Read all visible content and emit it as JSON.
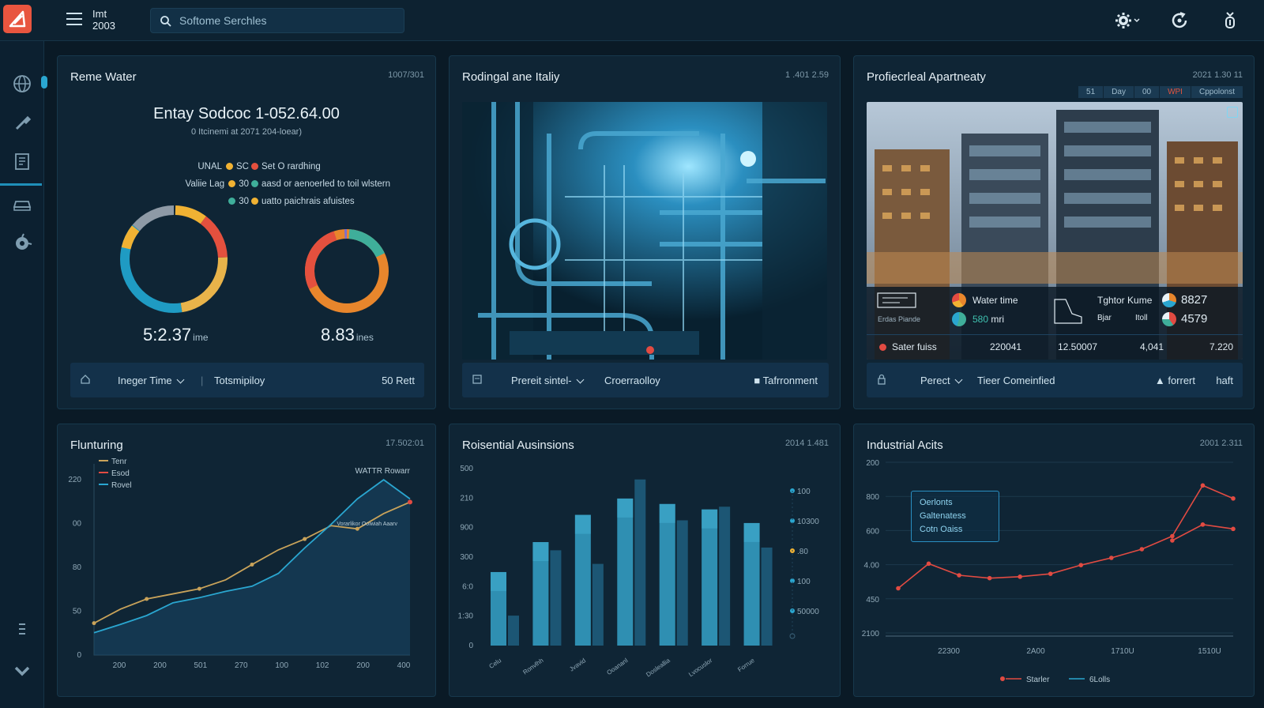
{
  "topbar": {
    "brand_line1": "Imt",
    "brand_line2": "2003",
    "search_placeholder": "Softome Serchles",
    "icons": [
      "settings-icon",
      "refresh-icon",
      "badge-icon"
    ]
  },
  "sidebar": {
    "items": [
      "globe-icon",
      "wrench-icon",
      "report-icon",
      "car-icon",
      "tools-icon",
      "list-icon",
      "chevron-down-icon"
    ]
  },
  "panels": {
    "water": {
      "title": "Reme Water",
      "stamp": "1007/301",
      "kpi_main": "Entay Sodcoc 1-052.64.00",
      "kpi_sub": "0 Itcinemi at 2071 204-loear)",
      "legend": [
        {
          "label_left": "UNAL",
          "left_color": "#f0b233",
          "label_right_prefix": "SC",
          "right_color": "#e4503e",
          "label_right": "Set O rardhing"
        },
        {
          "label_left": "Valiie Lag",
          "left_color": "#f0b233",
          "label_right_prefix": "30",
          "right_color": "#3fae9a",
          "label_right": "aasd or aenoerled to toil wlstern"
        },
        {
          "label_left": "",
          "left_color": "#3fae9a",
          "label_right_prefix": "30",
          "right_color": "#f0b233",
          "label_right": "uatto paichrais afuistes"
        }
      ],
      "donut1": {
        "value": "5:2.37",
        "unit": "ime"
      },
      "donut2": {
        "value": "8.83",
        "unit": "ines"
      },
      "footer": {
        "select": "Ineger Time",
        "text": "Totsmipiloy",
        "right": "50 Rett"
      }
    },
    "facility": {
      "title": "Rodingal ane Italiy",
      "stamp": "1 .401 2.59",
      "footer": {
        "select": "Prereit sintel-",
        "text": "Croerraolloy",
        "right": "Tafrronment"
      }
    },
    "apartment": {
      "title": "Profiecrleal Apartneaty",
      "stamp": "2021 1.30 11",
      "tabs": [
        "51",
        "Day",
        "00",
        "WPI",
        "Cppolonst"
      ],
      "overlay": {
        "water_time_label": "Water time",
        "water_time_value": "580",
        "water_time_unit": "mri",
        "tghtor_label": "Tghtor Kume",
        "tghtor_sub1": "Bjar",
        "tghtor_sub2": "Itoll",
        "val1": "8827",
        "val2": "4579",
        "small_label": "Erdas Piande",
        "status_label": "Sater fuiss",
        "status_values": [
          "220041",
          "12.50007",
          "4,041",
          "7.220"
        ]
      },
      "footer": {
        "select": "Perect",
        "text": "Tieer Comeinfied",
        "right": "forrert",
        "right2": "haft"
      }
    },
    "funding": {
      "title": "Flunturing",
      "stamp": "17.502:01",
      "chart_data": {
        "type": "line",
        "series": [
          {
            "name": "Tenr",
            "color": "#c9a35a",
            "values": [
              50,
              72,
              88,
              96,
              104,
              118,
              142,
              165,
              182,
              203,
              198,
              222,
              240
            ]
          },
          {
            "name": "Esod",
            "color": "#e24b42",
            "values": [
              null,
              null,
              null,
              null,
              null,
              null,
              null,
              null,
              null,
              null,
              null,
              null,
              240
            ]
          },
          {
            "name": "Rovel",
            "color": "#2aa6d0",
            "values": [
              35,
              48,
              62,
              82,
              90,
              100,
              108,
              128,
              168,
              205,
              245,
              275,
              245
            ]
          }
        ],
        "x_tick_labels": [
          "200",
          "200",
          "501",
          "270",
          "100",
          "102",
          "200",
          "400"
        ],
        "y_tick_labels": [
          "0",
          "50",
          "80",
          "00",
          "220"
        ],
        "annotation": "WATTR Rowarr",
        "annotation2": "Vorarlikor Ooiwiah Aaarv"
      }
    },
    "residential": {
      "title": "Roisential Ausinsions",
      "stamp": "2014 1.481",
      "chart_data": {
        "type": "bar",
        "categories": [
          "Celu",
          "Ronvlhh",
          "Jvavid",
          "Ooananl",
          "Dosleallia",
          "Lvocuslor",
          "Forrue"
        ],
        "series": [
          {
            "name": "a",
            "values": [
              270,
              380,
              480,
              540,
              520,
              500,
              450
            ]
          },
          {
            "name": "b",
            "values": [
              110,
              350,
              300,
              610,
              460,
              510,
              360
            ]
          }
        ],
        "y_tick_labels": [
          "0",
          "1:30",
          "6:0",
          "300",
          "900",
          "210",
          "500"
        ],
        "ymax": 650,
        "right_legend": [
          "100",
          "10300",
          ".80",
          "100",
          "50000"
        ]
      }
    },
    "industrial": {
      "title": "Industrial Acits",
      "stamp": "2001 2.311",
      "chart_data": {
        "type": "line",
        "series": [
          {
            "name": "Starler",
            "color": "#e24b42",
            "values": [
              165,
              250,
              210,
              200,
              205,
              215,
              245,
              270,
              300,
              345,
              520,
              475
            ]
          },
          {
            "name": "6Lolls",
            "color": "#e24b42",
            "values": [
              null,
              null,
              null,
              null,
              null,
              null,
              null,
              null,
              null,
              330,
              385,
              370
            ]
          }
        ],
        "x_tick_labels": [
          "22300",
          "2A00",
          "1710U",
          "1510U"
        ],
        "y_tick_labels": [
          "2100",
          "450",
          "4.00",
          "600",
          "800",
          "200"
        ],
        "tooltip": [
          "Oerlonts",
          "Galtenatess",
          "Cotn Oaiss"
        ],
        "legend": [
          "Starler",
          "6Lolls"
        ]
      }
    }
  }
}
